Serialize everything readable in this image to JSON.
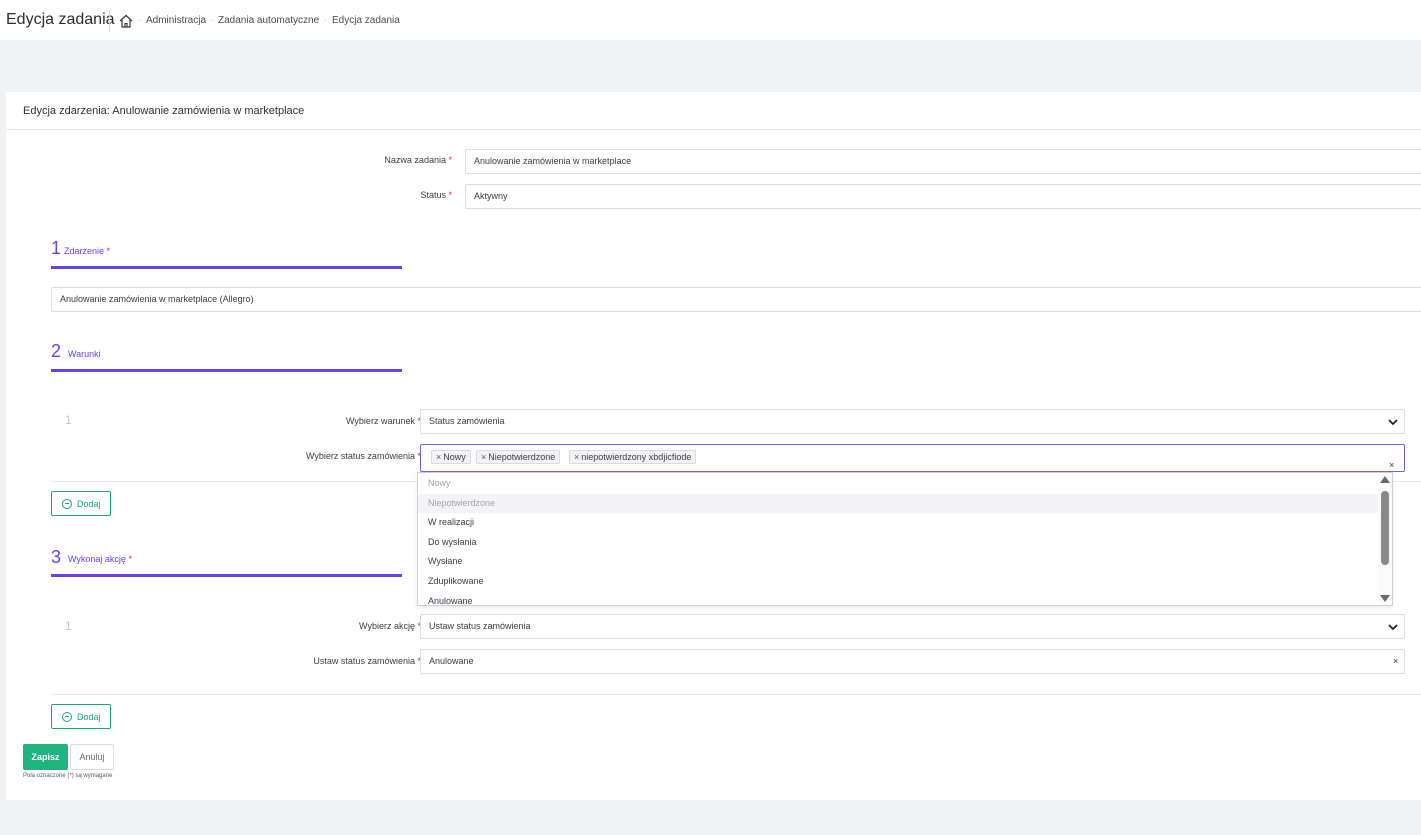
{
  "header": {
    "title": "Edycja zadania",
    "breadcrumb": [
      "Administracja",
      "Zadania automatyczne",
      "Edycja zadania"
    ]
  },
  "card": {
    "title": "Edycja zdarzenia: Anulowanie zamówienia w marketplace"
  },
  "form": {
    "name_label": "Nazwa zadania",
    "name_value": "Anulowanie zamówienia w marketplace",
    "status_label": "Status",
    "status_value": "Aktywny",
    "required_mark": "*"
  },
  "section1": {
    "number": "1",
    "title": "Zdarzenie",
    "event_value": "Anulowanie zamówienia w marketplace (Allegro)"
  },
  "section2": {
    "number": "2",
    "title": "Warunki",
    "row_index": "1",
    "condition_label": "Wybierz warunek",
    "condition_value": "Status zamówienia",
    "order_status_label": "Wybierz status zamówienia",
    "selected_tags": [
      "Nowy",
      "Niepotwierdzone",
      "niepotwierdzony xbdjicfiode"
    ],
    "tag_remove_glyph": "×",
    "clear_glyph": "×",
    "dropdown_options": [
      "Nowy",
      "Niepotwierdzone",
      "W realizacji",
      "Do wysłania",
      "Wysłane",
      "Zduplikowane",
      "Anulowane"
    ],
    "add_label": "Dodaj"
  },
  "section3": {
    "number": "3",
    "title": "Wykonaj akcję",
    "row_index": "1",
    "action_label": "Wybierz akcję",
    "action_value": "Ustaw status zamówienia",
    "set_status_label": "Ustaw status zamówienia",
    "set_status_value": "Anulowane",
    "clear_glyph": "×",
    "add_label": "Dodaj"
  },
  "footer": {
    "save_label": "Zapisz",
    "cancel_label": "Anuluj",
    "required_note": "Pola oznaczone (*) są wymagane"
  },
  "colors": {
    "accent": "#6a3ff1",
    "success": "#1fb37f",
    "required": "#e0243b"
  }
}
